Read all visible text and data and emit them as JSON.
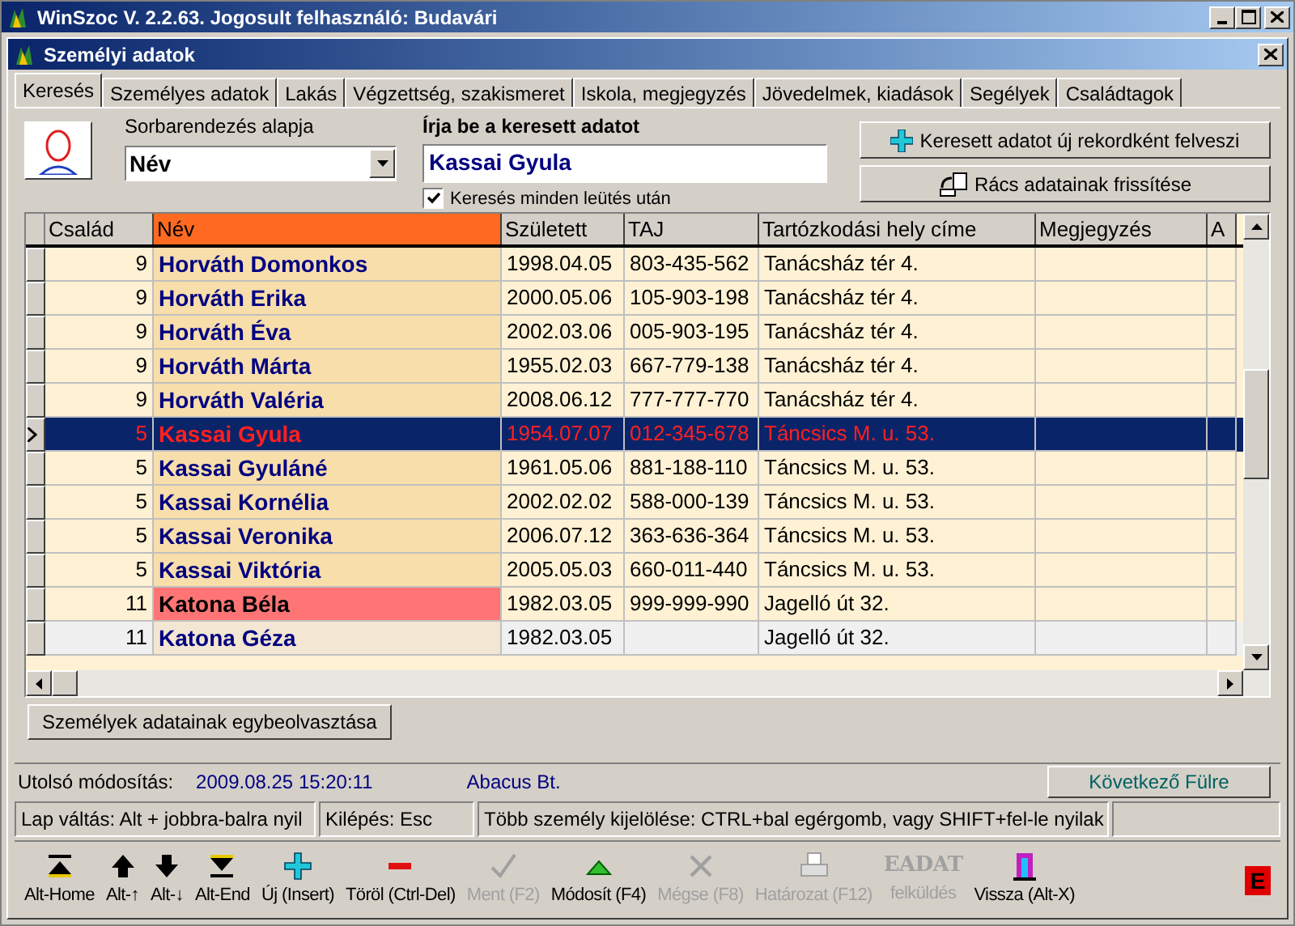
{
  "app_window": {
    "title": "WinSzoc V. 2.2.63.  Jogosult felhasználó: Budavári"
  },
  "child_window": {
    "title": "Személyi adatok"
  },
  "tabs": [
    {
      "label": "Keresés",
      "selected": true
    },
    {
      "label": "Személyes adatok",
      "selected": false
    },
    {
      "label": "Lakás",
      "selected": false
    },
    {
      "label": "Végzettség, szakismeret",
      "selected": false
    },
    {
      "label": "Iskola, megjegyzés",
      "selected": false
    },
    {
      "label": "Jövedelmek, kiadások",
      "selected": false
    },
    {
      "label": "Segélyek",
      "selected": false
    },
    {
      "label": "Családtagok",
      "selected": false
    }
  ],
  "search": {
    "sort_label": "Sorbarendezés alapja",
    "sort_value": "Név",
    "input_label": "Írja be a keresett adatot",
    "input_value": "Kassai Gyula",
    "live_search": {
      "label": "Keresés minden leütés után",
      "checked": true
    },
    "buttons": [
      "Keresett adatot új rekordként felveszi",
      "Rács adatainak frissítése"
    ]
  },
  "table": {
    "columns": [
      {
        "label": "Család",
        "selected": false
      },
      {
        "label": "Név",
        "selected": true
      },
      {
        "label": "Született",
        "selected": false
      },
      {
        "label": "TAJ",
        "selected": false
      },
      {
        "label": "Tartózkodási hely címe",
        "selected": false
      },
      {
        "label": "Megjegyzés",
        "selected": false
      },
      {
        "label": "A",
        "selected": false
      }
    ],
    "rows": [
      {
        "family": "9",
        "name": "Horváth Domonkos",
        "born": "1998.04.05",
        "taj": "803-435-562",
        "address": "Tanácsház tér 4.",
        "selected": false,
        "kind": "normal"
      },
      {
        "family": "9",
        "name": "Horváth Erika",
        "born": "2000.05.06",
        "taj": "105-903-198",
        "address": "Tanácsház tér 4.",
        "selected": false,
        "kind": "normal"
      },
      {
        "family": "9",
        "name": "Horváth Éva",
        "born": "2002.03.06",
        "taj": "005-903-195",
        "address": "Tanácsház tér 4.",
        "selected": false,
        "kind": "normal"
      },
      {
        "family": "9",
        "name": "Horváth Márta",
        "born": "1955.02.03",
        "taj": "667-779-138",
        "address": "Tanácsház tér 4.",
        "selected": false,
        "kind": "normal"
      },
      {
        "family": "9",
        "name": "Horváth Valéria",
        "born": "2008.06.12",
        "taj": "777-777-770",
        "address": "Tanácsház tér 4.",
        "selected": false,
        "kind": "normal"
      },
      {
        "family": "5",
        "name": "Kassai Gyula",
        "born": "1954.07.07",
        "taj": "012-345-678",
        "address": "Táncsics M. u. 53.",
        "selected": true,
        "kind": "normal"
      },
      {
        "family": "5",
        "name": "Kassai Gyuláné",
        "born": "1961.05.06",
        "taj": "881-188-110",
        "address": "Táncsics M. u. 53.",
        "selected": false,
        "kind": "normal"
      },
      {
        "family": "5",
        "name": "Kassai Kornélia",
        "born": "2002.02.02",
        "taj": "588-000-139",
        "address": "Táncsics M. u. 53.",
        "selected": false,
        "kind": "normal"
      },
      {
        "family": "5",
        "name": "Kassai Veronika",
        "born": "2006.07.12",
        "taj": "363-636-364",
        "address": "Táncsics M. u. 53.",
        "selected": false,
        "kind": "normal"
      },
      {
        "family": "5",
        "name": "Kassai Viktória",
        "born": "2005.05.03",
        "taj": "660-011-440",
        "address": "Táncsics M. u. 53.",
        "selected": false,
        "kind": "normal"
      },
      {
        "family": "11",
        "name": "Katona Béla",
        "born": "1982.03.05",
        "taj": "999-999-990",
        "address": "Jagelló út 32.",
        "selected": false,
        "kind": "marked"
      },
      {
        "family": "11",
        "name": "Katona Géza",
        "born": "1982.03.05",
        "address": "Jagelló út 32.",
        "selected": false,
        "kind": "grey"
      }
    ]
  },
  "merge_button": "Személyek adatainak egybeolvasztása",
  "info": {
    "label": "Utolsó módosítás:",
    "timestamp": "2009.08.25 15:20:11",
    "company": "Abacus Bt.",
    "next_button": "Következő Fülre"
  },
  "status_bar": [
    "Lap váltás: Alt + jobbra-balra nyil",
    "Kilépés: Esc",
    "Több személy kijelölése: CTRL+bal egérgomb, vagy SHIFT+fel-le nyilak"
  ],
  "toolbar": [
    {
      "kind": "first",
      "label": "Alt-Home",
      "disabled": false
    },
    {
      "kind": "up",
      "label": "Alt-↑",
      "disabled": false
    },
    {
      "kind": "down",
      "label": "Alt-↓",
      "disabled": false
    },
    {
      "kind": "last",
      "label": "Alt-End",
      "disabled": false
    },
    {
      "kind": "new",
      "label": "Új (Insert)",
      "disabled": false
    },
    {
      "kind": "delete",
      "label": "Töröl (Ctrl-Del)",
      "disabled": false
    },
    {
      "kind": "save",
      "label": "Ment (F2)",
      "disabled": true
    },
    {
      "kind": "edit",
      "label": "Módosít (F4)",
      "disabled": false
    },
    {
      "kind": "cancel",
      "label": "Mégse (F8)",
      "disabled": true
    },
    {
      "kind": "print",
      "label": "Határozat (F12)",
      "disabled": true
    },
    {
      "kind": "upload",
      "label": "felküldés",
      "icon_text": "EADAT",
      "disabled": true
    },
    {
      "kind": "exit",
      "label": "Vissza (Alt-X)",
      "disabled": false
    }
  ],
  "indicator": {
    "text": "E"
  }
}
